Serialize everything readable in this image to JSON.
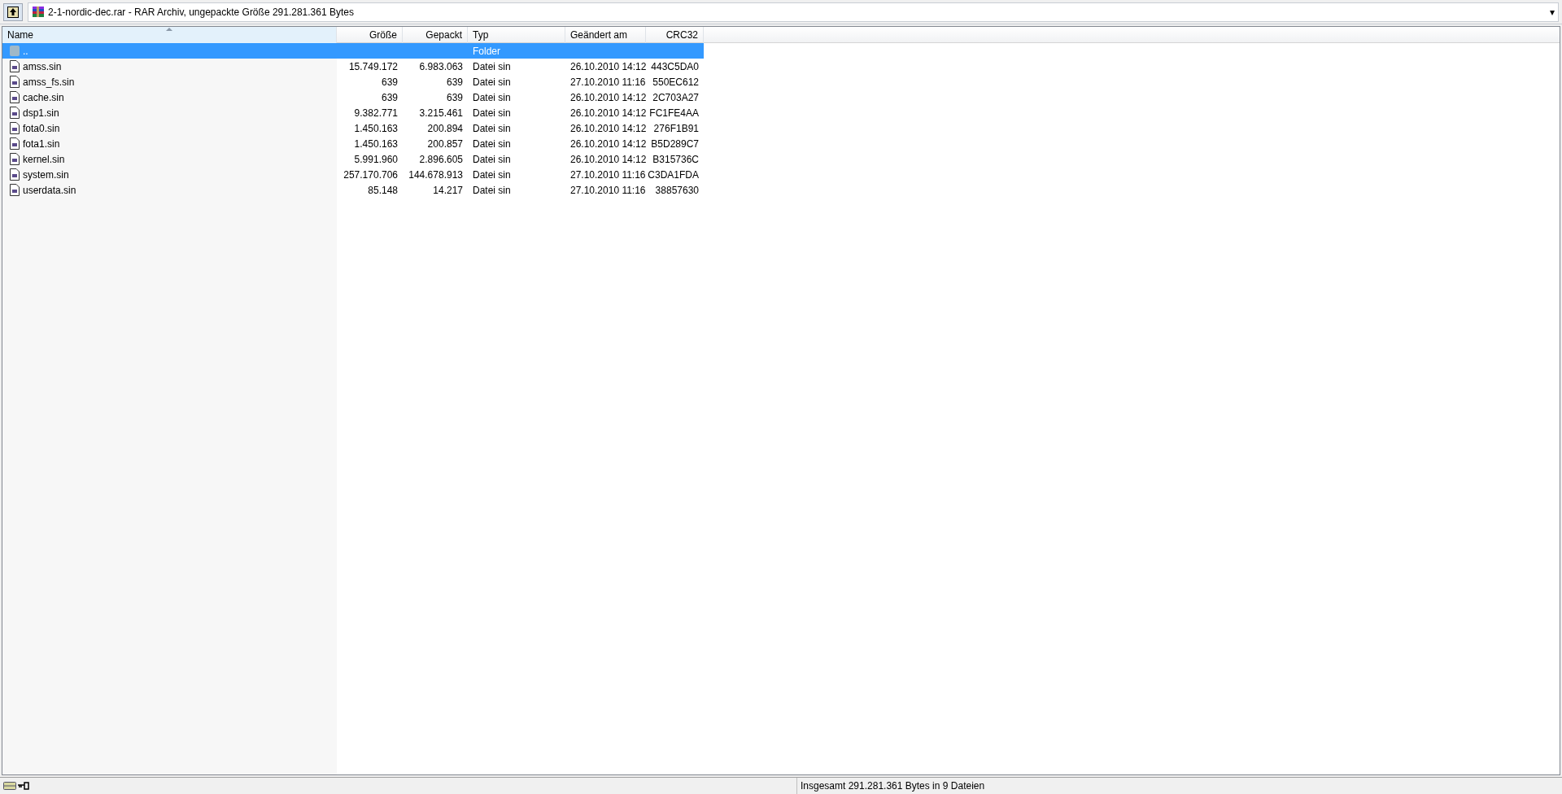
{
  "address_bar": {
    "text": "2-1-nordic-dec.rar - RAR Archiv, ungepackte Größe 291.281.361 Bytes",
    "dropdown": "▾"
  },
  "table": {
    "columns": [
      {
        "label": "Name",
        "sorted": true
      },
      {
        "label": "Größe",
        "sorted": false
      },
      {
        "label": "Gepackt",
        "sorted": false
      },
      {
        "label": "Typ",
        "sorted": false
      },
      {
        "label": "Geändert am",
        "sorted": false
      },
      {
        "label": "CRC32",
        "sorted": false
      }
    ],
    "rows": [
      {
        "kind": "folder",
        "selected": true,
        "cells": [
          "..",
          "",
          "",
          "Folder",
          "",
          ""
        ]
      },
      {
        "kind": "file",
        "selected": false,
        "cells": [
          "amss.sin",
          "15.749.172",
          "6.983.063",
          "Datei sin",
          "26.10.2010 14:12",
          "443C5DA0"
        ]
      },
      {
        "kind": "file",
        "selected": false,
        "cells": [
          "amss_fs.sin",
          "639",
          "639",
          "Datei sin",
          "27.10.2010 11:16",
          "550EC612"
        ]
      },
      {
        "kind": "file",
        "selected": false,
        "cells": [
          "cache.sin",
          "639",
          "639",
          "Datei sin",
          "26.10.2010 14:12",
          "2C703A27"
        ]
      },
      {
        "kind": "file",
        "selected": false,
        "cells": [
          "dsp1.sin",
          "9.382.771",
          "3.215.461",
          "Datei sin",
          "26.10.2010 14:12",
          "FC1FE4AA"
        ]
      },
      {
        "kind": "file",
        "selected": false,
        "cells": [
          "fota0.sin",
          "1.450.163",
          "200.894",
          "Datei sin",
          "26.10.2010 14:12",
          "276F1B91"
        ]
      },
      {
        "kind": "file",
        "selected": false,
        "cells": [
          "fota1.sin",
          "1.450.163",
          "200.857",
          "Datei sin",
          "26.10.2010 14:12",
          "B5D289C7"
        ]
      },
      {
        "kind": "file",
        "selected": false,
        "cells": [
          "kernel.sin",
          "5.991.960",
          "2.896.605",
          "Datei sin",
          "26.10.2010 14:12",
          "B315736C"
        ]
      },
      {
        "kind": "file",
        "selected": false,
        "cells": [
          "system.sin",
          "257.170.706",
          "144.678.913",
          "Datei sin",
          "27.10.2010 11:16",
          "C3DA1FDA"
        ]
      },
      {
        "kind": "file",
        "selected": false,
        "cells": [
          "userdata.sin",
          "85.148",
          "14.217",
          "Datei sin",
          "27.10.2010 11:16",
          "38857630"
        ]
      }
    ]
  },
  "status_bar": {
    "text": "Insgesamt 291.281.361 Bytes in 9 Dateien"
  }
}
